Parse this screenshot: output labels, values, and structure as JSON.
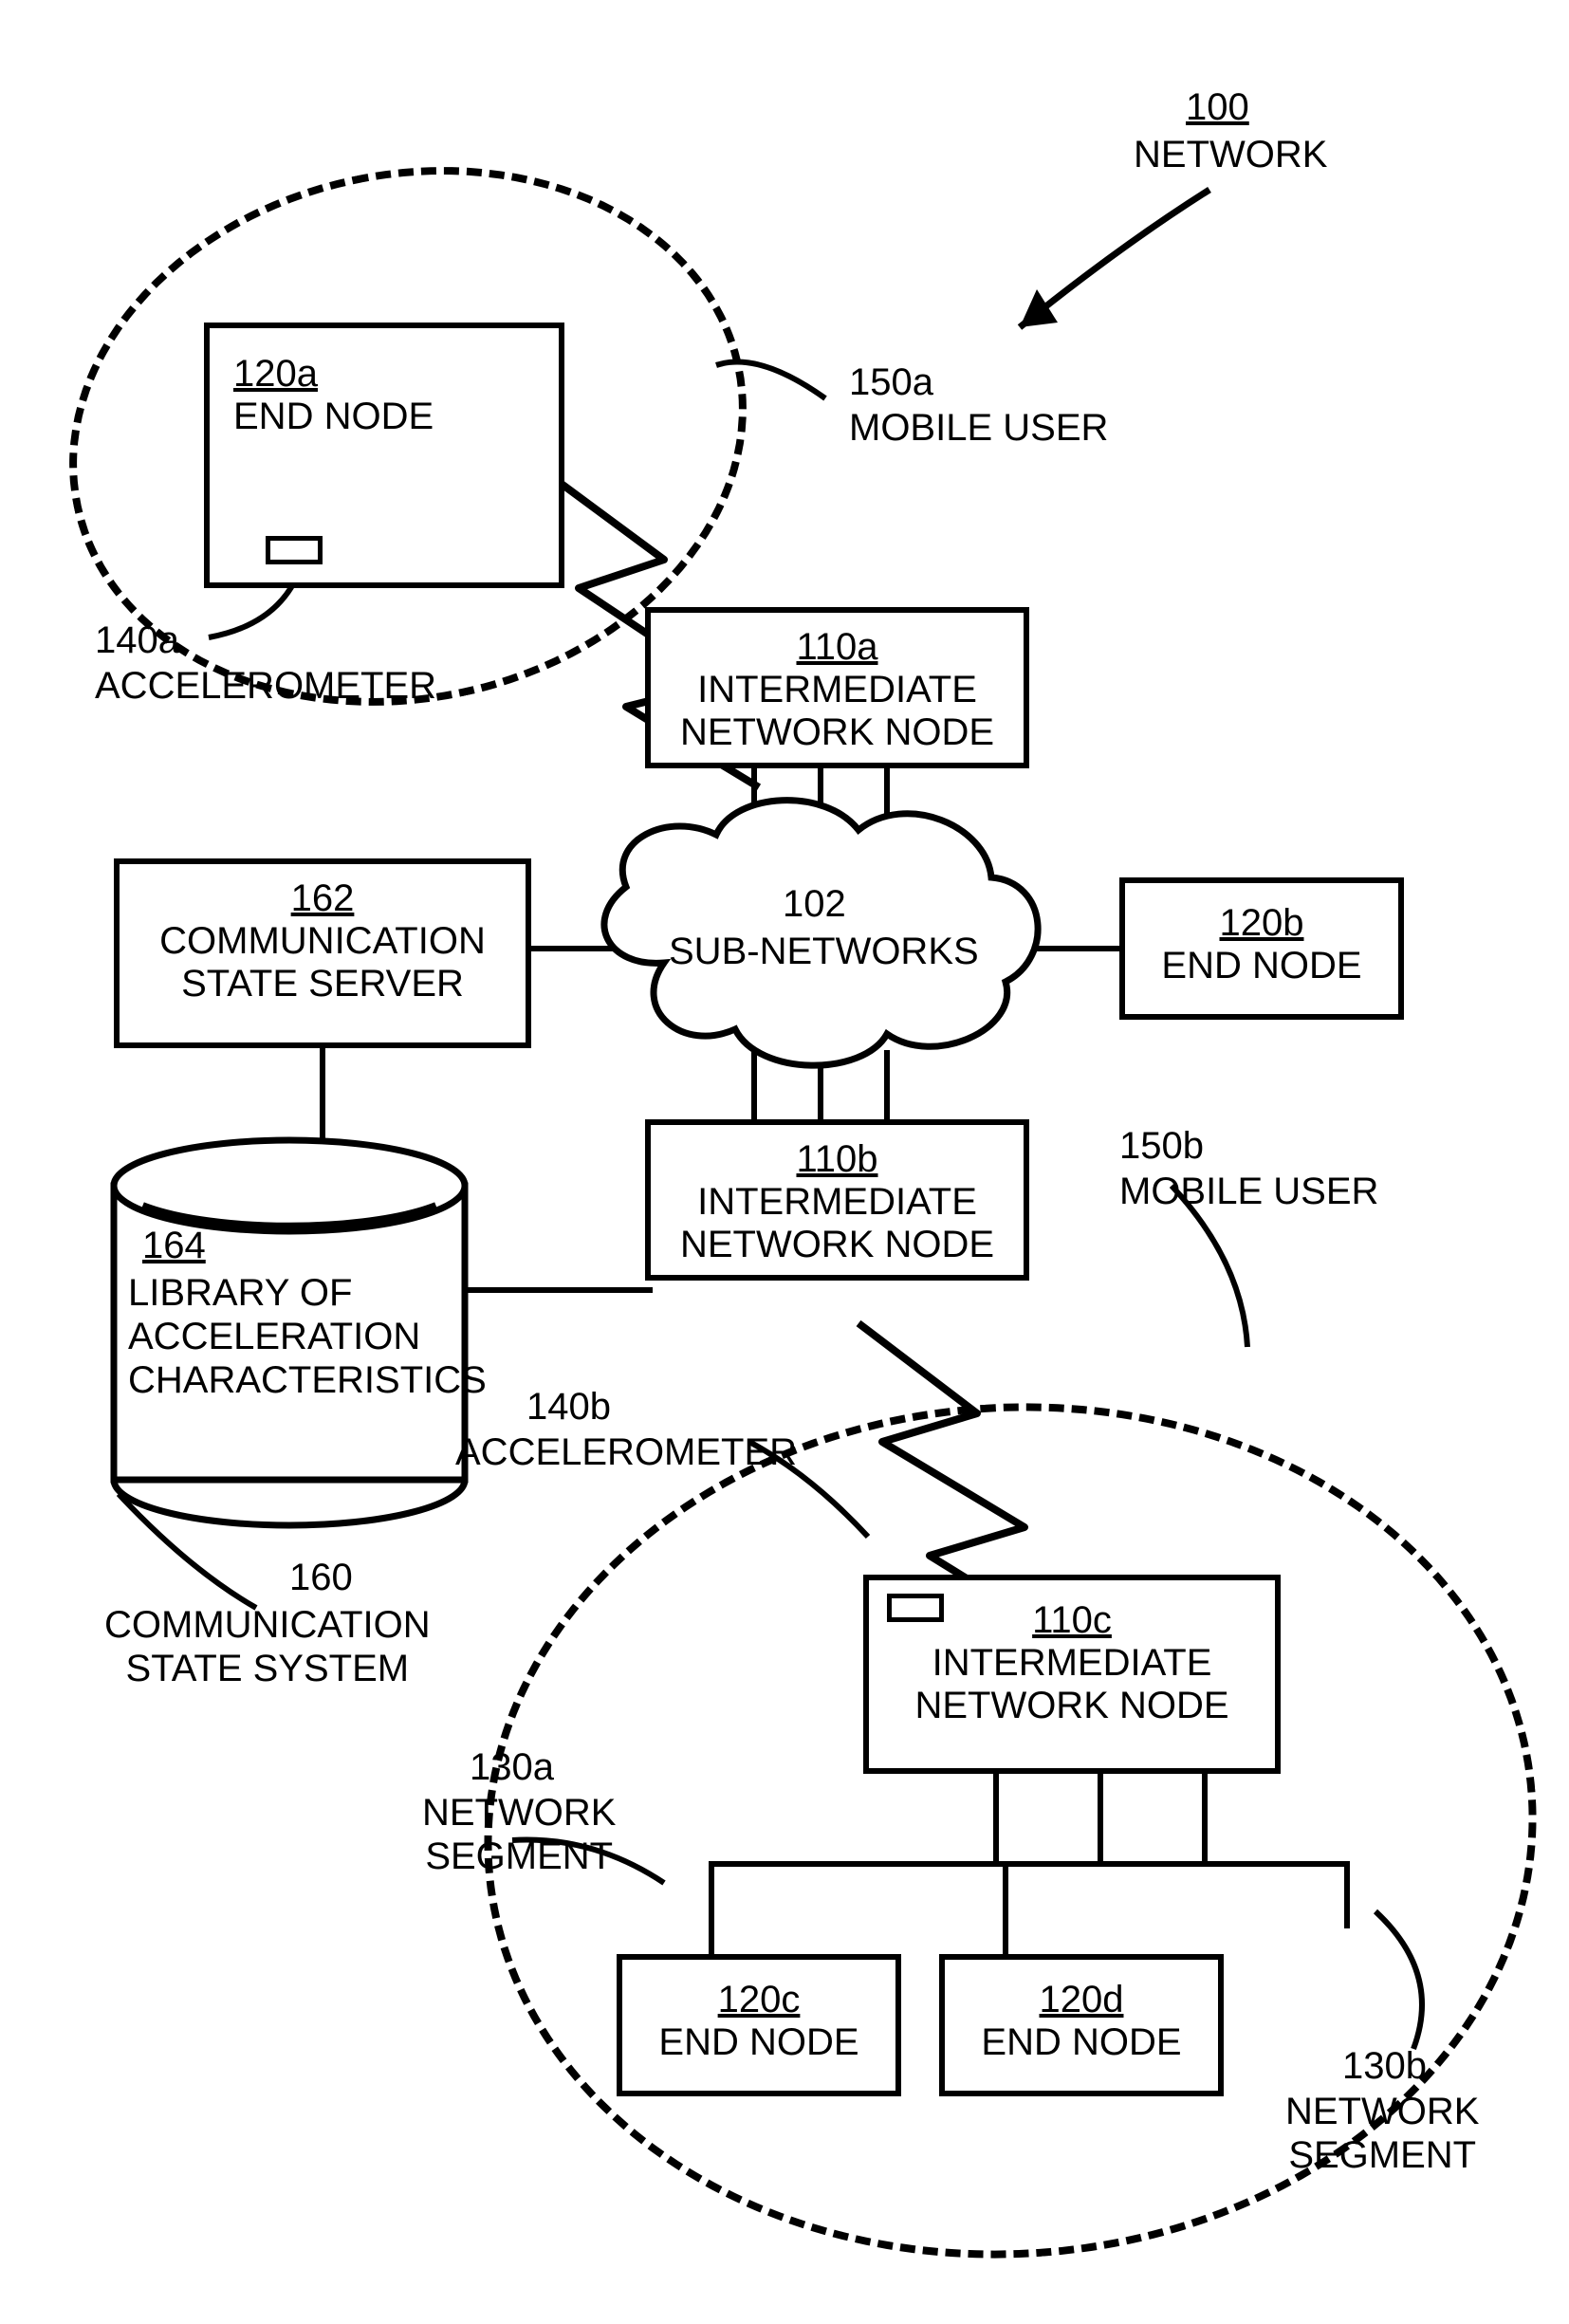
{
  "refs": {
    "r100": "100",
    "r102": "102",
    "r110a": "110a",
    "r110b": "110b",
    "r110c": "110c",
    "r120a": "120a",
    "r120b": "120b",
    "r120c": "120c",
    "r120d": "120d",
    "r130a": "130a",
    "r130b": "130b",
    "r140a": "140a",
    "r140b": "140b",
    "r150a": "150a",
    "r150b": "150b",
    "r160": "160",
    "r162": "162",
    "r164": "164"
  },
  "captions": {
    "network": "NETWORK",
    "subnetworks": "SUB-NETWORKS",
    "intermediate": "INTERMEDIATE\nNETWORK NODE",
    "endnode": "END NODE",
    "mobileuser": "MOBILE USER",
    "accelerometer": "ACCELEROMETER",
    "commserver": "COMMUNICATION\nSTATE SERVER",
    "library": "LIBRARY OF\nACCELERATION\nCHARACTERISTICS",
    "commsys": "COMMUNICATION\nSTATE SYSTEM",
    "segment": "NETWORK\nSEGMENT"
  }
}
